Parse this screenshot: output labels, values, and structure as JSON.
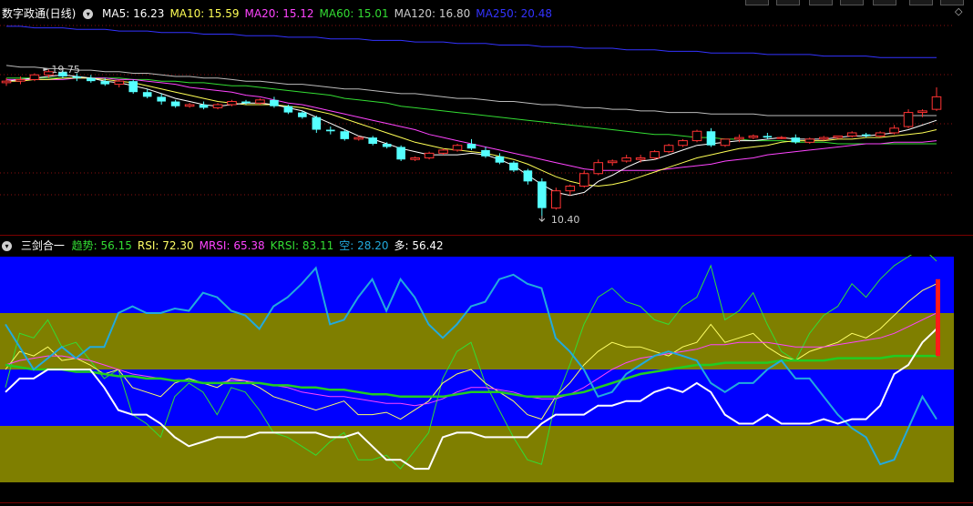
{
  "main_panel": {
    "title": "数字政通(日线)",
    "ma_items": [
      {
        "label": "MA5: 16.23",
        "color": "#ffffff"
      },
      {
        "label": "MA10: 15.59",
        "color": "#ffff55"
      },
      {
        "label": "MA20: 15.12",
        "color": "#ff44ff"
      },
      {
        "label": "MA60: 15.01",
        "color": "#33dd33"
      },
      {
        "label": "MA120: 16.80",
        "color": "#cccccc"
      },
      {
        "label": "MA250: 20.48",
        "color": "#3333ff"
      }
    ],
    "high_label": "19.75",
    "low_label": "10.40"
  },
  "indicator_panel": {
    "title": "三剑合一",
    "items": [
      {
        "label": "趋势: 56.15",
        "color": "#33dd33"
      },
      {
        "label": "RSI: 72.30",
        "color": "#ffff66"
      },
      {
        "label": "MRSI: 65.38",
        "color": "#ff44ff"
      },
      {
        "label": "KRSI: 83.11",
        "color": "#33dd33"
      },
      {
        "label": "空: 28.20",
        "color": "#22aadd"
      },
      {
        "label": "多: 56.42",
        "color": "#ffffff"
      }
    ]
  },
  "colors": {
    "up": "#ff3333",
    "down": "#55ffff",
    "band_blue": "#0000ff",
    "band_olive": "#7f7f00"
  },
  "chart_data": {
    "type": "line",
    "candles_ohlc": [
      [
        18.9,
        19.2,
        18.7,
        19.0
      ],
      [
        19.0,
        19.3,
        18.8,
        19.1
      ],
      [
        19.1,
        19.5,
        19.0,
        19.4
      ],
      [
        19.4,
        19.75,
        19.2,
        19.6
      ],
      [
        19.6,
        19.7,
        19.2,
        19.3
      ],
      [
        19.3,
        19.5,
        19.0,
        19.2
      ],
      [
        19.2,
        19.4,
        18.9,
        19.0
      ],
      [
        19.0,
        19.2,
        18.7,
        18.8
      ],
      [
        18.8,
        19.1,
        18.6,
        19.0
      ],
      [
        19.0,
        19.1,
        18.2,
        18.3
      ],
      [
        18.3,
        18.5,
        17.9,
        18.0
      ],
      [
        18.0,
        18.2,
        17.5,
        17.7
      ],
      [
        17.7,
        17.8,
        17.3,
        17.4
      ],
      [
        17.4,
        17.6,
        17.3,
        17.5
      ],
      [
        17.5,
        17.7,
        17.2,
        17.3
      ],
      [
        17.3,
        17.6,
        17.2,
        17.5
      ],
      [
        17.5,
        17.8,
        17.4,
        17.7
      ],
      [
        17.7,
        17.8,
        17.5,
        17.6
      ],
      [
        17.6,
        17.9,
        17.5,
        17.8
      ],
      [
        17.8,
        18.0,
        17.3,
        17.4
      ],
      [
        17.4,
        17.5,
        16.9,
        17.0
      ],
      [
        17.0,
        17.1,
        16.6,
        16.7
      ],
      [
        16.7,
        16.8,
        15.7,
        15.9
      ],
      [
        15.9,
        16.1,
        15.6,
        15.8
      ],
      [
        15.8,
        15.9,
        15.2,
        15.3
      ],
      [
        15.3,
        15.5,
        15.2,
        15.4
      ],
      [
        15.4,
        15.5,
        14.9,
        15.0
      ],
      [
        15.0,
        15.1,
        14.7,
        14.8
      ],
      [
        14.8,
        14.9,
        13.9,
        14.0
      ],
      [
        14.0,
        14.2,
        13.9,
        14.1
      ],
      [
        14.1,
        14.5,
        14.0,
        14.4
      ],
      [
        14.4,
        14.7,
        14.3,
        14.6
      ],
      [
        14.6,
        15.0,
        14.5,
        14.9
      ],
      [
        15.0,
        15.3,
        14.6,
        14.7
      ],
      [
        14.6,
        14.8,
        14.1,
        14.2
      ],
      [
        14.2,
        14.4,
        13.7,
        13.8
      ],
      [
        13.8,
        13.9,
        13.2,
        13.3
      ],
      [
        13.3,
        13.4,
        12.4,
        12.6
      ],
      [
        12.6,
        12.8,
        10.4,
        10.9
      ],
      [
        10.9,
        12.2,
        10.8,
        12.0
      ],
      [
        12.0,
        12.4,
        11.7,
        12.3
      ],
      [
        12.3,
        13.3,
        12.2,
        13.1
      ],
      [
        13.1,
        14.0,
        13.0,
        13.8
      ],
      [
        13.8,
        14.0,
        13.6,
        13.9
      ],
      [
        13.9,
        14.3,
        13.8,
        14.1
      ],
      [
        14.0,
        14.3,
        13.8,
        14.1
      ],
      [
        14.1,
        14.6,
        14.0,
        14.5
      ],
      [
        14.5,
        15.0,
        14.4,
        14.9
      ],
      [
        14.9,
        15.3,
        14.8,
        15.2
      ],
      [
        15.2,
        15.9,
        15.1,
        15.8
      ],
      [
        15.8,
        16.0,
        14.8,
        14.9
      ],
      [
        14.9,
        15.3,
        14.8,
        15.3
      ],
      [
        15.3,
        15.6,
        15.1,
        15.4
      ],
      [
        15.4,
        15.6,
        15.3,
        15.5
      ],
      [
        15.5,
        15.7,
        15.3,
        15.4
      ],
      [
        15.4,
        15.5,
        15.3,
        15.4
      ],
      [
        15.4,
        15.6,
        15.0,
        15.1
      ],
      [
        15.1,
        15.4,
        15.0,
        15.3
      ],
      [
        15.3,
        15.5,
        15.2,
        15.4
      ],
      [
        15.4,
        15.5,
        15.3,
        15.5
      ],
      [
        15.5,
        15.8,
        15.4,
        15.7
      ],
      [
        15.6,
        15.7,
        15.4,
        15.5
      ],
      [
        15.5,
        15.8,
        15.4,
        15.7
      ],
      [
        15.7,
        16.2,
        15.6,
        16.0
      ],
      [
        16.1,
        17.2,
        16.0,
        17.0
      ],
      [
        17.0,
        17.2,
        16.7,
        17.1
      ],
      [
        17.2,
        18.6,
        17.1,
        18.0
      ]
    ],
    "ma5": [
      19.0,
      19.1,
      19.2,
      19.3,
      19.4,
      19.3,
      19.2,
      19.0,
      18.9,
      18.7,
      18.5,
      18.2,
      17.9,
      17.7,
      17.5,
      17.4,
      17.5,
      17.6,
      17.6,
      17.5,
      17.3,
      17.1,
      16.7,
      16.3,
      15.9,
      15.5,
      15.3,
      15.0,
      14.7,
      14.5,
      14.3,
      14.3,
      14.3,
      14.4,
      14.3,
      14.0,
      13.6,
      13.0,
      12.4,
      11.9,
      11.7,
      11.9,
      12.6,
      13.0,
      13.5,
      13.9,
      14.0,
      14.3,
      14.6,
      14.9,
      15.0,
      15.1,
      15.2,
      15.2,
      15.3,
      15.4,
      15.3,
      15.3,
      15.3,
      15.4,
      15.5,
      15.5,
      15.6,
      15.7,
      15.9,
      16.2,
      16.5
    ],
    "ma10": [
      19.0,
      19.0,
      19.1,
      19.1,
      19.2,
      19.2,
      19.2,
      19.1,
      19.0,
      18.9,
      18.7,
      18.5,
      18.3,
      18.1,
      17.9,
      17.7,
      17.6,
      17.5,
      17.5,
      17.5,
      17.4,
      17.3,
      17.1,
      16.9,
      16.6,
      16.3,
      16.0,
      15.7,
      15.4,
      15.1,
      14.9,
      14.7,
      14.6,
      14.5,
      14.4,
      14.2,
      14.0,
      13.7,
      13.3,
      12.9,
      12.6,
      12.4,
      12.3,
      12.4,
      12.6,
      12.9,
      13.2,
      13.5,
      13.8,
      14.1,
      14.3,
      14.5,
      14.7,
      14.8,
      14.9,
      15.1,
      15.2,
      15.2,
      15.2,
      15.3,
      15.3,
      15.4,
      15.4,
      15.5,
      15.6,
      15.7,
      15.9
    ],
    "ma20": [
      19.1,
      19.1,
      19.1,
      19.1,
      19.1,
      19.2,
      19.2,
      19.2,
      19.1,
      19.1,
      19.0,
      18.9,
      18.8,
      18.6,
      18.5,
      18.4,
      18.3,
      18.1,
      18.0,
      17.8,
      17.6,
      17.5,
      17.3,
      17.1,
      16.9,
      16.7,
      16.5,
      16.3,
      16.1,
      15.9,
      15.6,
      15.4,
      15.2,
      15.0,
      14.8,
      14.6,
      14.4,
      14.2,
      14.0,
      13.8,
      13.6,
      13.4,
      13.3,
      13.3,
      13.3,
      13.3,
      13.3,
      13.4,
      13.5,
      13.6,
      13.7,
      13.9,
      14.0,
      14.1,
      14.3,
      14.4,
      14.5,
      14.6,
      14.7,
      14.8,
      14.9,
      15.0,
      15.0,
      15.1,
      15.1,
      15.1,
      15.2
    ],
    "ma60": [
      19.2,
      19.2,
      19.2,
      19.2,
      19.2,
      19.2,
      19.2,
      19.2,
      19.2,
      19.1,
      19.1,
      19.0,
      19.0,
      18.9,
      18.9,
      18.8,
      18.7,
      18.7,
      18.6,
      18.5,
      18.4,
      18.3,
      18.2,
      18.1,
      17.9,
      17.8,
      17.7,
      17.6,
      17.4,
      17.3,
      17.2,
      17.1,
      17.0,
      16.9,
      16.8,
      16.7,
      16.6,
      16.5,
      16.4,
      16.3,
      16.2,
      16.1,
      16.0,
      15.9,
      15.8,
      15.7,
      15.6,
      15.6,
      15.5,
      15.4,
      15.4,
      15.3,
      15.3,
      15.2,
      15.2,
      15.2,
      15.1,
      15.1,
      15.1,
      15.0,
      15.0,
      15.0,
      15.0,
      15.0,
      15.0,
      15.0,
      15.0
    ],
    "ma120": [
      20.0,
      19.9,
      19.9,
      19.8,
      19.8,
      19.7,
      19.7,
      19.6,
      19.6,
      19.5,
      19.5,
      19.4,
      19.3,
      19.3,
      19.2,
      19.2,
      19.1,
      19.0,
      19.0,
      18.9,
      18.8,
      18.8,
      18.7,
      18.6,
      18.5,
      18.5,
      18.4,
      18.3,
      18.2,
      18.2,
      18.1,
      18.0,
      17.9,
      17.9,
      17.8,
      17.7,
      17.7,
      17.6,
      17.5,
      17.5,
      17.4,
      17.3,
      17.3,
      17.2,
      17.2,
      17.1,
      17.1,
      17.0,
      17.0,
      17.0,
      16.9,
      16.9,
      16.9,
      16.9,
      16.8,
      16.8,
      16.8,
      16.8,
      16.8,
      16.8,
      16.8,
      16.8,
      16.8,
      16.8,
      16.8,
      16.8,
      16.8
    ],
    "ma250": [
      22.5,
      22.5,
      22.4,
      22.4,
      22.4,
      22.3,
      22.3,
      22.3,
      22.2,
      22.2,
      22.2,
      22.1,
      22.1,
      22.1,
      22.0,
      22.0,
      22.0,
      21.9,
      21.9,
      21.9,
      21.8,
      21.8,
      21.8,
      21.7,
      21.7,
      21.7,
      21.6,
      21.6,
      21.6,
      21.5,
      21.5,
      21.5,
      21.4,
      21.4,
      21.4,
      21.3,
      21.3,
      21.3,
      21.2,
      21.2,
      21.2,
      21.1,
      21.1,
      21.1,
      21.0,
      21.0,
      21.0,
      20.9,
      20.9,
      20.9,
      20.8,
      20.8,
      20.8,
      20.8,
      20.7,
      20.7,
      20.7,
      20.7,
      20.6,
      20.6,
      20.6,
      20.6,
      20.5,
      20.5,
      20.5,
      20.5,
      20.5
    ],
    "ind_trend": [
      52,
      51,
      50,
      50,
      50,
      49,
      49,
      48,
      47,
      47,
      46,
      46,
      45,
      45,
      44,
      44,
      44,
      44,
      44,
      43,
      43,
      42,
      42,
      41,
      41,
      40,
      39,
      39,
      38,
      38,
      38,
      38,
      39,
      40,
      40,
      40,
      39,
      38,
      38,
      38,
      39,
      40,
      42,
      44,
      46,
      48,
      49,
      50,
      51,
      52,
      52,
      53,
      53,
      53,
      53,
      54,
      54,
      54,
      54,
      55,
      55,
      55,
      55,
      56,
      56,
      56,
      56
    ],
    "ind_rsi": [
      50,
      58,
      56,
      60,
      54,
      55,
      52,
      48,
      50,
      42,
      40,
      38,
      44,
      46,
      44,
      42,
      46,
      45,
      42,
      38,
      36,
      34,
      32,
      34,
      36,
      30,
      30,
      31,
      28,
      32,
      36,
      44,
      48,
      50,
      44,
      40,
      36,
      30,
      28,
      38,
      44,
      52,
      58,
      62,
      60,
      60,
      58,
      56,
      60,
      62,
      70,
      62,
      64,
      66,
      60,
      56,
      54,
      58,
      60,
      62,
      66,
      64,
      68,
      74,
      80,
      85,
      88
    ],
    "ind_mrsi": [
      52,
      54,
      55,
      56,
      56,
      55,
      54,
      52,
      50,
      48,
      47,
      46,
      45,
      45,
      44,
      44,
      45,
      45,
      44,
      43,
      42,
      40,
      39,
      38,
      38,
      37,
      36,
      35,
      35,
      34,
      35,
      37,
      40,
      42,
      42,
      41,
      40,
      38,
      37,
      37,
      39,
      42,
      46,
      50,
      53,
      55,
      56,
      57,
      58,
      59,
      61,
      61,
      62,
      62,
      62,
      61,
      60,
      60,
      60,
      61,
      62,
      63,
      64,
      66,
      69,
      72,
      75
    ],
    "ind_krsi": [
      42,
      66,
      64,
      72,
      60,
      62,
      54,
      46,
      50,
      30,
      26,
      20,
      38,
      44,
      40,
      30,
      42,
      40,
      32,
      22,
      20,
      16,
      12,
      18,
      22,
      10,
      10,
      12,
      6,
      14,
      22,
      46,
      58,
      62,
      44,
      32,
      20,
      10,
      8,
      36,
      52,
      70,
      82,
      86,
      80,
      78,
      72,
      70,
      78,
      82,
      96,
      72,
      76,
      84,
      70,
      58,
      54,
      66,
      74,
      78,
      88,
      82,
      90,
      96,
      100,
      104,
      98
    ],
    "ind_kong": [
      70,
      60,
      50,
      55,
      60,
      55,
      60,
      60,
      75,
      78,
      75,
      75,
      77,
      76,
      84,
      82,
      76,
      74,
      68,
      78,
      82,
      88,
      95,
      70,
      72,
      82,
      90,
      76,
      90,
      82,
      70,
      64,
      70,
      78,
      80,
      90,
      92,
      88,
      86,
      64,
      58,
      50,
      38,
      40,
      48,
      52,
      56,
      58,
      56,
      54,
      44,
      40,
      44,
      44,
      50,
      54,
      46,
      46,
      38,
      30,
      24,
      20,
      8,
      10,
      24,
      38,
      28
    ],
    "ind_duo": [
      40,
      46,
      46,
      50,
      50,
      50,
      50,
      42,
      32,
      30,
      30,
      26,
      20,
      16,
      18,
      20,
      20,
      20,
      22,
      22,
      22,
      22,
      22,
      20,
      20,
      22,
      16,
      10,
      10,
      6,
      6,
      20,
      22,
      22,
      20,
      20,
      20,
      20,
      26,
      30,
      30,
      30,
      34,
      34,
      36,
      36,
      40,
      42,
      40,
      44,
      40,
      30,
      26,
      26,
      30,
      26,
      26,
      26,
      28,
      26,
      28,
      28,
      34,
      48,
      52,
      62,
      68
    ]
  }
}
